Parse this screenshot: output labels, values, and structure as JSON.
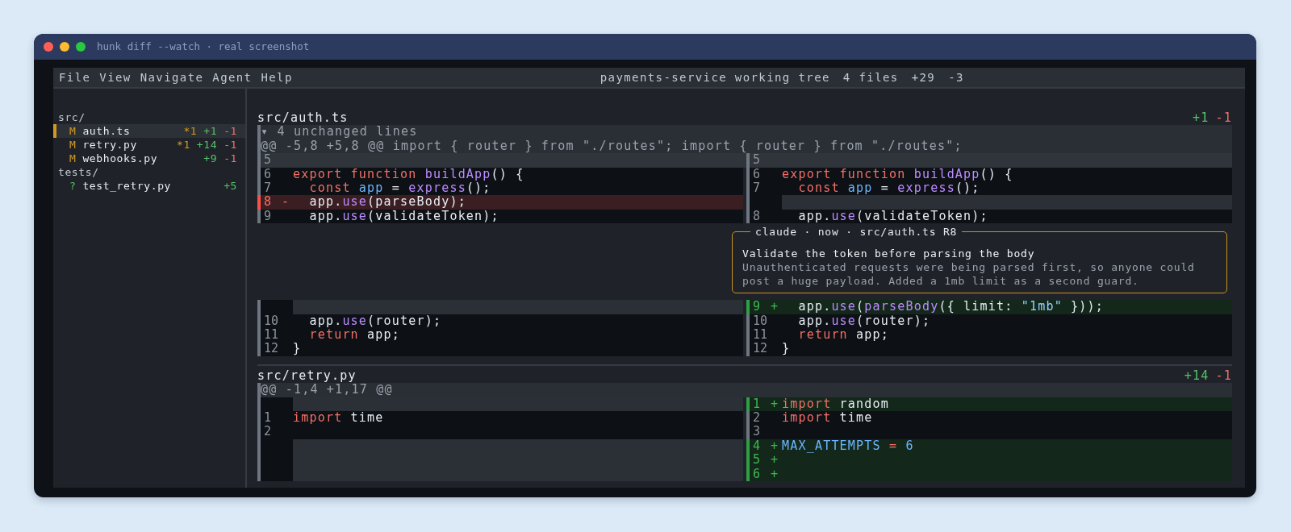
{
  "window": {
    "title": "hunk diff --watch · real screenshot"
  },
  "menu": [
    "File",
    "View",
    "Navigate",
    "Agent",
    "Help"
  ],
  "summary": {
    "title": "payments-service working tree",
    "files": "4 files",
    "added": "+29",
    "removed": "-3"
  },
  "sidebar": {
    "tree": [
      {
        "name": "src/",
        "children": [
          {
            "kind": "modified",
            "status": "M",
            "name": "auth.ts",
            "comments": "*1",
            "added": "+1",
            "removed": "-1",
            "selected": true
          },
          {
            "kind": "modified",
            "status": "M",
            "name": "retry.py",
            "comments": "*1",
            "added": "+14",
            "removed": "-1",
            "selected": false
          },
          {
            "kind": "modified",
            "status": "M",
            "name": "webhooks.py",
            "added": "+9",
            "removed": "-1",
            "selected": false
          }
        ]
      },
      {
        "name": "tests/",
        "children": [
          {
            "kind": "untracked",
            "status": "?",
            "name": "test_retry.py",
            "added": "+5",
            "selected": false
          }
        ]
      }
    ]
  },
  "files": [
    {
      "path": "src/auth.ts",
      "added": "+1",
      "removed": "-1",
      "collapsed": "▾ 4 unchanged lines",
      "hunk_header": "@@ -5,8 +5,8 @@ import { router } from \"./routes\"; import { router } from \"./routes\";",
      "rows": [
        {
          "selected": true,
          "left": {
            "kind": "context",
            "number": "5"
          },
          "right": {
            "kind": "context",
            "number": "5"
          }
        },
        {
          "selected": false,
          "left": {
            "kind": "context",
            "number": "6",
            "tokens": [
              {
                "kind": "kw",
                "text": "export function "
              },
              {
                "kind": "fn",
                "text": "buildApp"
              },
              {
                "kind": "txt",
                "text": "() {"
              }
            ]
          },
          "right": {
            "kind": "context",
            "number": "6",
            "tokens": [
              {
                "kind": "kw",
                "text": "export function "
              },
              {
                "kind": "fn",
                "text": "buildApp"
              },
              {
                "kind": "txt",
                "text": "() {"
              }
            ]
          }
        },
        {
          "selected": false,
          "left": {
            "kind": "context",
            "number": "7",
            "tokens": [
              {
                "kind": "kw",
                "text": "  const "
              },
              {
                "kind": "var",
                "text": "app"
              },
              {
                "kind": "txt",
                "text": " = "
              },
              {
                "kind": "fn",
                "text": "express"
              },
              {
                "kind": "txt",
                "text": "();"
              }
            ]
          },
          "right": {
            "kind": "context",
            "number": "7",
            "tokens": [
              {
                "kind": "kw",
                "text": "  const "
              },
              {
                "kind": "var",
                "text": "app"
              },
              {
                "kind": "txt",
                "text": " = "
              },
              {
                "kind": "fn",
                "text": "express"
              },
              {
                "kind": "txt",
                "text": "();"
              }
            ]
          }
        },
        {
          "selected": false,
          "left": {
            "kind": "removed",
            "number": "8",
            "sign": "-",
            "tokens": [
              {
                "kind": "txt",
                "text": "  app."
              },
              {
                "kind": "fn",
                "text": "use"
              },
              {
                "kind": "txt",
                "text": "(parseBody);"
              }
            ]
          },
          "right": {
            "kind": "filler"
          }
        },
        {
          "selected": false,
          "left": {
            "kind": "context",
            "number": "9",
            "tokens": [
              {
                "kind": "txt",
                "text": "  app."
              },
              {
                "kind": "fn",
                "text": "use"
              },
              {
                "kind": "txt",
                "text": "(validateToken);"
              }
            ]
          },
          "right": {
            "kind": "context",
            "number": "8",
            "tokens": [
              {
                "kind": "txt",
                "text": "  app."
              },
              {
                "kind": "fn",
                "text": "use"
              },
              {
                "kind": "txt",
                "text": "(validateToken);"
              }
            ]
          }
        },
        {
          "selected": false,
          "comment": {
            "header": "claude · now · src/auth.ts R8",
            "title": "Validate the token before parsing the body",
            "body": "Unauthenticated requests were being parsed first, so anyone could post a huge payload. Added a 1mb limit as a second guard."
          }
        },
        {
          "selected": false,
          "left": {
            "kind": "filler"
          },
          "right": {
            "kind": "added",
            "number": "9",
            "sign": "+",
            "tokens": [
              {
                "kind": "txt",
                "text": "  app."
              },
              {
                "kind": "fn",
                "text": "use"
              },
              {
                "kind": "txt",
                "text": "("
              },
              {
                "kind": "fn",
                "text": "parseBody"
              },
              {
                "kind": "txt",
                "text": "({ limit: "
              },
              {
                "kind": "str",
                "text": "\"1mb\""
              },
              {
                "kind": "txt",
                "text": " }));"
              }
            ]
          }
        },
        {
          "selected": false,
          "left": {
            "kind": "context",
            "number": "10",
            "tokens": [
              {
                "kind": "txt",
                "text": "  app."
              },
              {
                "kind": "fn",
                "text": "use"
              },
              {
                "kind": "txt",
                "text": "(router);"
              }
            ]
          },
          "right": {
            "kind": "context",
            "number": "10",
            "tokens": [
              {
                "kind": "txt",
                "text": "  app."
              },
              {
                "kind": "fn",
                "text": "use"
              },
              {
                "kind": "txt",
                "text": "(router);"
              }
            ]
          }
        },
        {
          "selected": false,
          "left": {
            "kind": "context",
            "number": "11",
            "tokens": [
              {
                "kind": "kw",
                "text": "  return"
              },
              {
                "kind": "txt",
                "text": " app;"
              }
            ]
          },
          "right": {
            "kind": "context",
            "number": "11",
            "tokens": [
              {
                "kind": "kw",
                "text": "  return"
              },
              {
                "kind": "txt",
                "text": " app;"
              }
            ]
          }
        },
        {
          "selected": false,
          "left": {
            "kind": "context",
            "number": "12",
            "tokens": [
              {
                "kind": "txt",
                "text": "}"
              }
            ]
          },
          "right": {
            "kind": "context",
            "number": "12",
            "tokens": [
              {
                "kind": "txt",
                "text": "}"
              }
            ]
          }
        }
      ]
    },
    {
      "path": "src/retry.py",
      "added": "+14",
      "removed": "-1",
      "hunk_header": "@@ -1,4 +1,17 @@",
      "rows": [
        {
          "selected": false,
          "left": {
            "kind": "filler"
          },
          "right": {
            "kind": "added",
            "number": "1",
            "sign": "+",
            "tokens": [
              {
                "kind": "kw",
                "text": "import"
              },
              {
                "kind": "txt",
                "text": " random"
              }
            ]
          }
        },
        {
          "selected": false,
          "left": {
            "kind": "context",
            "number": "1",
            "tokens": [
              {
                "kind": "kw",
                "text": "import"
              },
              {
                "kind": "txt",
                "text": " time"
              }
            ]
          },
          "right": {
            "kind": "context",
            "number": "2",
            "tokens": [
              {
                "kind": "kw",
                "text": "import"
              },
              {
                "kind": "txt",
                "text": " time"
              }
            ]
          }
        },
        {
          "selected": false,
          "left": {
            "kind": "context",
            "number": "2"
          },
          "right": {
            "kind": "context",
            "number": "3"
          }
        },
        {
          "selected": false,
          "left": {
            "kind": "filler"
          },
          "right": {
            "kind": "added",
            "number": "4",
            "sign": "+",
            "tokens": [
              {
                "kind": "var",
                "text": "MAX_ATTEMPTS "
              },
              {
                "kind": "op",
                "text": "= "
              },
              {
                "kind": "var",
                "text": "6"
              }
            ]
          }
        },
        {
          "selected": false,
          "left": {
            "kind": "filler"
          },
          "right": {
            "kind": "added",
            "number": "5",
            "sign": "+"
          }
        },
        {
          "selected": false,
          "left": {
            "kind": "filler"
          },
          "right": {
            "kind": "added",
            "number": "6",
            "sign": "+"
          }
        }
      ]
    }
  ]
}
